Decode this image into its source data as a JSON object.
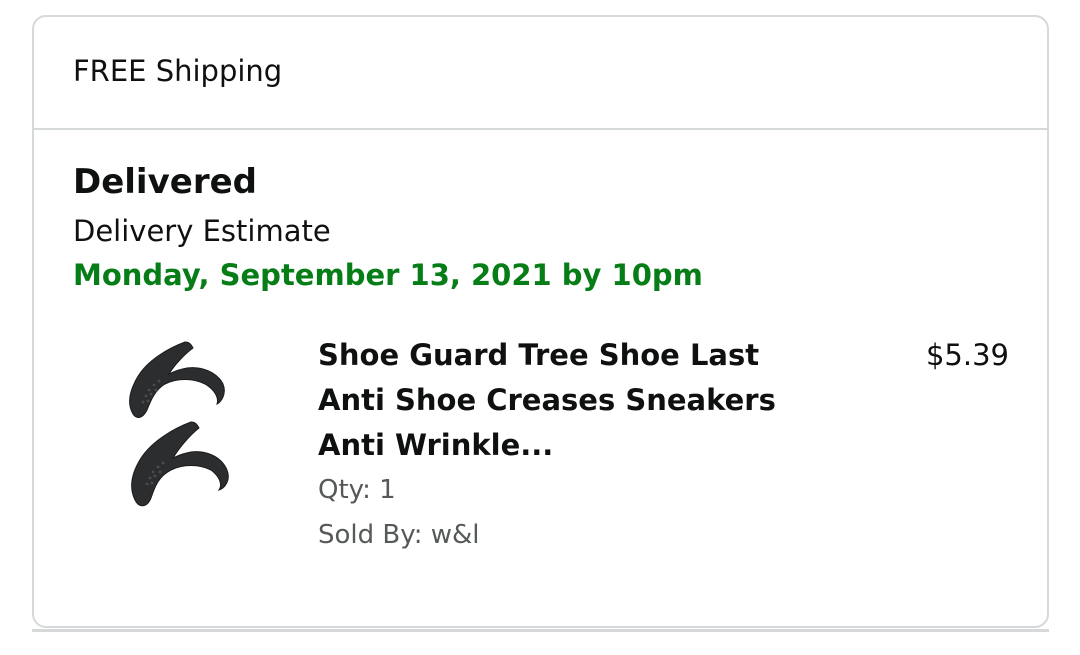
{
  "shipping": {
    "label": "FREE Shipping"
  },
  "delivery": {
    "status": "Delivered",
    "estimate_label": "Delivery Estimate",
    "estimate_date": "Monday, September 13, 2021 by 10pm",
    "estimate_color": "#067d17"
  },
  "item": {
    "title_line1": "Shoe Guard Tree Shoe Last",
    "title_line2": "Anti Shoe Creases Sneakers",
    "title_line3": "Anti Wrinkle...",
    "quantity": "Qty: 1",
    "sold_by": "Sold By: w&l",
    "price": "$5.39",
    "image_icon": "shoe-guard-product-image"
  }
}
